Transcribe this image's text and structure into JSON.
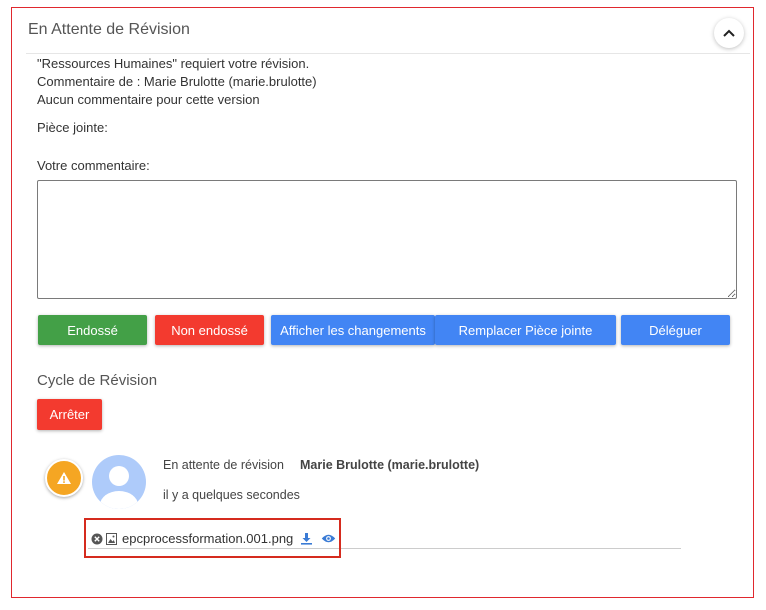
{
  "panel": {
    "title": "En Attente de Révision"
  },
  "review": {
    "request_line": "\"Ressources Humaines\" requiert votre révision.",
    "comment_by": "Commentaire de : Marie Brulotte (marie.brulotte)",
    "no_comment": "Aucun commentaire pour cette version",
    "attachment_label": "Pièce jointe:",
    "your_comment_label": "Votre commentaire:",
    "comment_value": ""
  },
  "actions": {
    "endorsed": "Endossé",
    "not_endorsed": "Non endossé",
    "show_changes": "Afficher les changements",
    "replace_attachment": "Remplacer Pièce jointe",
    "delegate": "Déléguer"
  },
  "cycle": {
    "title": "Cycle de Révision",
    "stop": "Arrêter",
    "entry": {
      "status": "En attente de révision",
      "user": "Marie Brulotte (marie.brulotte)",
      "time": "il y a quelques secondes",
      "file_name": "epcprocessformation.001.png"
    }
  },
  "colors": {
    "green": "#43a047",
    "red": "#f33a2f",
    "blue": "#4285f4",
    "warning": "#f5a623",
    "highlight_border": "#d52b1e"
  },
  "icons": {
    "collapse": "chevron-up-icon",
    "warning": "warning-icon",
    "avatar": "user-avatar-icon",
    "remove": "remove-circle-icon",
    "file": "image-file-icon",
    "download": "download-icon",
    "view": "eye-icon"
  }
}
